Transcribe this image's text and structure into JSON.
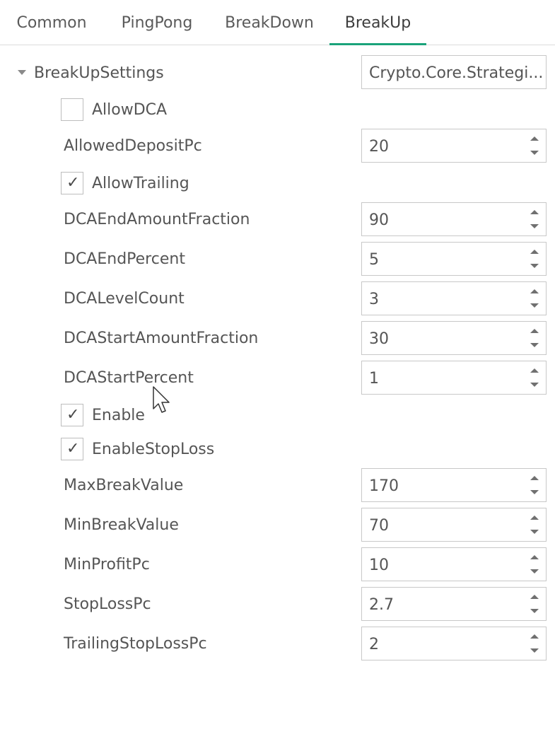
{
  "tabs": [
    {
      "label": "Common"
    },
    {
      "label": "PingPong"
    },
    {
      "label": "BreakDown"
    },
    {
      "label": "BreakUp"
    }
  ],
  "active_tab": "BreakUp",
  "group": {
    "label": "BreakUpSettings",
    "value": "Crypto.Core.Strategi..."
  },
  "properties": {
    "allow_dca": {
      "label": "AllowDCA",
      "checked": false
    },
    "allowed_deposit_pc": {
      "label": "AllowedDepositPc",
      "value": "20"
    },
    "allow_trailing": {
      "label": "AllowTrailing",
      "checked": true
    },
    "dca_end_amount_fraction": {
      "label": "DCAEndAmountFraction",
      "value": "90"
    },
    "dca_end_percent": {
      "label": "DCAEndPercent",
      "value": "5"
    },
    "dca_level_count": {
      "label": "DCALevelCount",
      "value": "3"
    },
    "dca_start_amount_fraction": {
      "label": "DCAStartAmountFraction",
      "value": "30"
    },
    "dca_start_percent": {
      "label": "DCAStartPercent",
      "value": "1"
    },
    "enable": {
      "label": "Enable",
      "checked": true
    },
    "enable_stop_loss": {
      "label": "EnableStopLoss",
      "checked": true
    },
    "max_break_value": {
      "label": "MaxBreakValue",
      "value": "170"
    },
    "min_break_value": {
      "label": "MinBreakValue",
      "value": "70"
    },
    "min_profit_pc": {
      "label": "MinProfitPc",
      "value": "10"
    },
    "stop_loss_pc": {
      "label": "StopLossPc",
      "value": "2.7"
    },
    "trailing_stop_loss_pc": {
      "label": "TrailingStopLossPc",
      "value": "2"
    }
  },
  "check_glyph": "✓",
  "colors": {
    "accent": "#1aa37a",
    "border": "#c8c8c8",
    "text": "#555555"
  }
}
